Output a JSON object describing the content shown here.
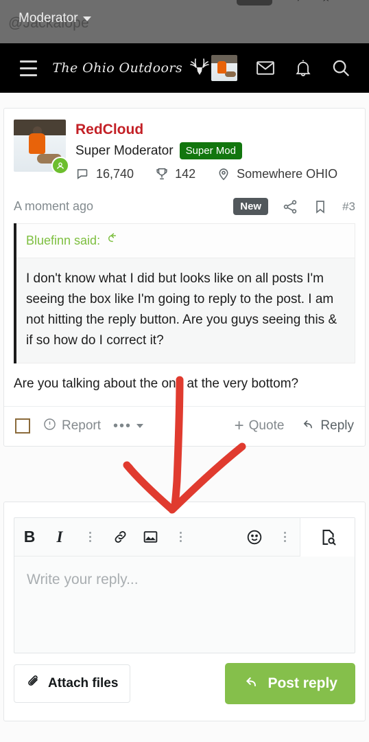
{
  "overlay": {
    "ghost_handle": "@Jackalope",
    "dropdown_label": "Moderator",
    "caret_icon": "chevron-down-icon"
  },
  "navbar": {
    "menu_icon": "hamburger-menu-icon",
    "brand": "The Ohio Outdoors",
    "brand_logo_icon": "deer-skull-antlers-icon",
    "avatar_icon": "user-avatar-icon",
    "inbox_icon": "envelope-icon",
    "alerts_icon": "bell-icon",
    "search_icon": "search-icon"
  },
  "post": {
    "author": "RedCloud",
    "role": "Super Moderator",
    "badge": "Super Mod",
    "messages_icon": "comment-icon",
    "messages_count": "16,740",
    "reactions_icon": "trophy-icon",
    "reactions_count": "142",
    "location_icon": "map-pin-icon",
    "location": "Somewhere OHIO",
    "timestamp": "A moment ago",
    "new_badge": "New",
    "share_icon": "share-icon",
    "bookmark_icon": "bookmark-icon",
    "post_number": "#3",
    "status_icon": "online-status-icon",
    "avatar_icon": "post-author-avatar"
  },
  "quote": {
    "author_line": "Bluefinn said:",
    "jump_icon": "reply-arrow-icon",
    "text": "I don't know what I did but looks like on all posts I'm seeing the box like I'm going to reply to the post. I am not hitting the reply button. Are you guys seeing this & if so how do I correct it?"
  },
  "post_body": "Are you talking about the one at the very bottom?",
  "post_actions": {
    "select_checkbox": "select-post-checkbox",
    "report_icon": "warning-circle-icon",
    "report_label": "Report",
    "more_icon": "more-horizontal-icon",
    "more_caret_icon": "chevron-down-icon",
    "quote_icon": "plus-icon",
    "quote_label": "Quote",
    "reply_icon": "reply-arrow-icon",
    "reply_label": "Reply"
  },
  "editor": {
    "toolbar": [
      {
        "name": "bold-button",
        "glyph": "B"
      },
      {
        "name": "italic-button",
        "glyph": "I"
      },
      {
        "name": "more-text-options-icon",
        "glyph": "vertical-dots"
      },
      {
        "name": "insert-link-button",
        "glyph": "link-icon"
      },
      {
        "name": "insert-image-button",
        "glyph": "image-icon"
      },
      {
        "name": "more-insert-options-icon",
        "glyph": "vertical-dots"
      },
      {
        "name": "emoji-button",
        "glyph": "smiley-icon"
      },
      {
        "name": "more-options-icon",
        "glyph": "vertical-dots"
      }
    ],
    "preview_icon": "document-preview-icon",
    "placeholder": "Write your reply...",
    "attach_icon": "paperclip-icon",
    "attach_label": "Attach files",
    "post_icon": "reply-arrow-icon",
    "post_label": "Post reply"
  },
  "annotation": {
    "type": "hand-drawn-arrow",
    "color": "#e03b2f",
    "points_to": "editor toolbar image button"
  },
  "colors": {
    "brand_red": "#c32026",
    "badge_green": "#12760e",
    "button_green": "#85bf4b",
    "quote_green": "#7dbf3f",
    "annotation_red": "#e03b2f",
    "nav_black": "#000000"
  }
}
